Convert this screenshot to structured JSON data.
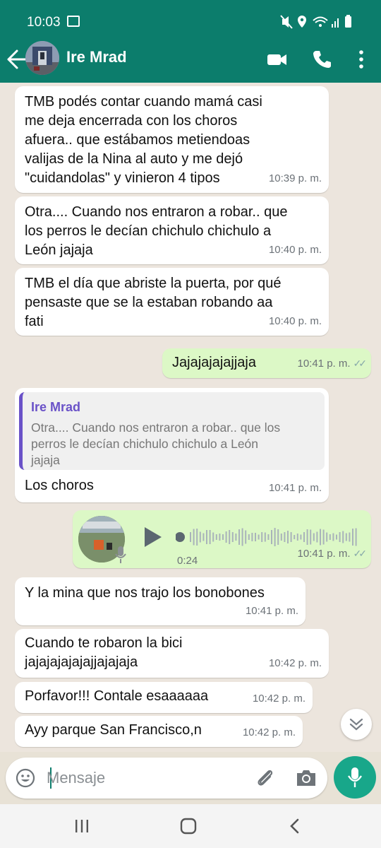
{
  "status_bar": {
    "time": "10:03"
  },
  "header": {
    "contact_name": "Ire Mrad"
  },
  "messages": [
    {
      "text": "TMB podés contar cuando mamá casi\nme deja encerrada con los choros\nafuera.. que estábamos metiendoas\nvalijas de la Nina al auto y me dejó\n\"cuidandolas\" y vinieron 4 tipos",
      "time": "10:39 p. m."
    },
    {
      "text": "Otra.... Cuando nos entraron a robar.. que\nlos perros le decían chichulo chichulo a\nLeón jajaja",
      "time": "10:40 p. m."
    },
    {
      "text": "TMB el día que abriste la puerta, por qué\npensaste que se la estaban robando aa\nfati",
      "time": "10:40 p. m."
    },
    {
      "text": "Jajajajajajjaja",
      "time": "10:41 p. m."
    },
    {
      "quote_author": "Ire Mrad",
      "quote_text": "Otra.... Cuando nos entraron a robar.. que los\nperros le decían chichulo chichulo a León\njajaja",
      "text": "Los choros",
      "time": "10:41 p. m."
    },
    {
      "duration": "0:24",
      "time": "10:41 p. m."
    },
    {
      "text": "Y la mina que nos trajo los bonobones",
      "time": "10:41 p. m."
    },
    {
      "text": "Cuando te robaron la bici\njajajajajajajjajajaja",
      "time": "10:42 p. m."
    },
    {
      "text": "Porfavor!!! Contale esaaaaaa",
      "time": "10:42 p. m."
    },
    {
      "text": "Ayy parque San Francisco,n",
      "time": "10:42 p. m."
    }
  ],
  "composer": {
    "placeholder": "Mensaje"
  },
  "colors": {
    "header": "#0c7d6c",
    "outgoing_bubble": "#dcf8c6",
    "accent": "#18a78a",
    "quote_author": "#6a52c8"
  },
  "icons": [
    "back-arrow-icon",
    "video-call-icon",
    "phone-icon",
    "more-options-icon",
    "emoji-icon",
    "attach-icon",
    "camera-icon",
    "mic-icon",
    "play-icon",
    "scroll-down-icon"
  ]
}
